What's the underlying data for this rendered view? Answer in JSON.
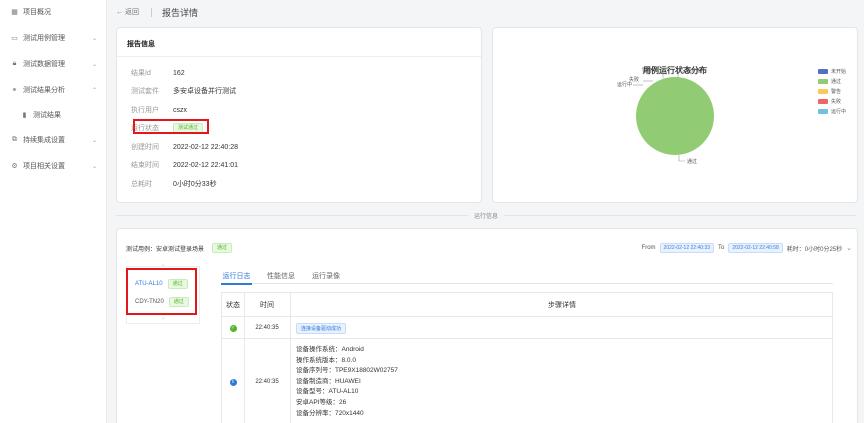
{
  "sidebar": {
    "items": [
      {
        "label": "项目概况",
        "icon": "dashboard-icon"
      },
      {
        "label": "测试用例管理",
        "icon": "folder-icon"
      },
      {
        "label": "测试数据管理",
        "icon": "lock-icon"
      },
      {
        "label": "测试结果分析",
        "icon": "link-icon"
      },
      {
        "label": "测试结果",
        "icon": "bar-chart-icon"
      },
      {
        "label": "持续集成设置",
        "icon": "integration-icon"
      },
      {
        "label": "项目相关设置",
        "icon": "gear-icon"
      }
    ]
  },
  "header": {
    "back_label": "← 返回",
    "title": "报告详情"
  },
  "report": {
    "title": "报告信息",
    "fields": [
      {
        "key": "结果Id",
        "value": "162"
      },
      {
        "key": "测试套件",
        "value": "多安卓设备并行测试"
      },
      {
        "key": "执行用户",
        "value": "cszx"
      },
      {
        "key": "运行状态",
        "value": "测试通过"
      },
      {
        "key": "创建时间",
        "value": "2022-02-12 22:40:28"
      },
      {
        "key": "结束时间",
        "value": "2022-02-12 22:41:01"
      },
      {
        "key": "总耗时",
        "value": "0小时0分33秒"
      }
    ]
  },
  "chart_data": {
    "type": "pie",
    "title": "用例运行状态分布",
    "labels": [
      "未开始",
      "通过",
      "警告",
      "失败",
      "运行中"
    ],
    "values": [
      0,
      1,
      0,
      0,
      0
    ],
    "colors": [
      "#5470c6",
      "#91cc75",
      "#fac858",
      "#ee6666",
      "#73c0de"
    ],
    "legend": "top-right"
  },
  "run_info": {
    "divider_label": "运行信息",
    "case_label": "测试用例：安卓测试登录场景",
    "case_status": "通过",
    "from_label": "From",
    "from_time": "2022-02-12 22:40:33",
    "to_label": "To",
    "to_time": "2022-02-12 22:40:58",
    "duration": "耗时：0小时0分25秒",
    "devices": [
      {
        "name": "ATU-AL10",
        "status": "通过"
      },
      {
        "name": "CDY-TN20",
        "status": "通过"
      }
    ],
    "tabs": [
      "运行日志",
      "性能信息",
      "运行录像"
    ],
    "table": {
      "headers": [
        "状态",
        "时间",
        "步骤详情"
      ],
      "rows": [
        {
          "status_icon": "check-circle-icon",
          "time": "22:40:35",
          "detail": "连接设备驱动成功"
        },
        {
          "status_icon": "info-circle-icon",
          "time": "22:40:35",
          "lines": [
            "设备操作系统：Android",
            "操作系统版本：8.0.0",
            "设备序列号：TPE9X18802W02757",
            "设备制造商：HUAWEI",
            "设备型号：ATU-AL10",
            "安卓API等级：26",
            "设备分辨率：720x1440"
          ]
        }
      ]
    }
  }
}
